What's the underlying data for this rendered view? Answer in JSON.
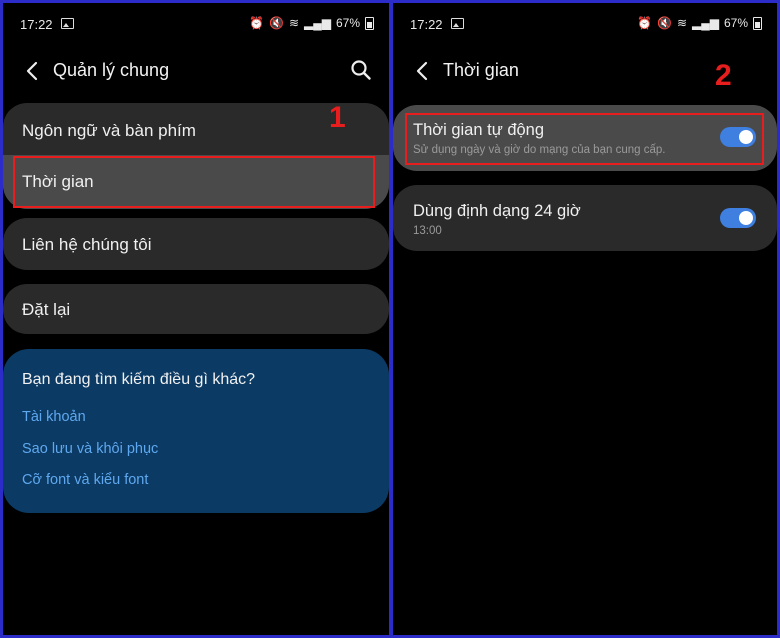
{
  "left": {
    "status": {
      "time": "17:22",
      "battery": "67%"
    },
    "appbar": {
      "title": "Quản lý chung"
    },
    "items": [
      {
        "label": "Ngôn ngữ và bàn phím"
      },
      {
        "label": "Thời gian"
      },
      {
        "label": "Liên hệ chúng tôi"
      },
      {
        "label": "Đặt lại"
      }
    ],
    "step_number": "1",
    "info": {
      "question": "Bạn đang tìm kiếm điều gì khác?",
      "links": [
        "Tài khoản",
        "Sao lưu và khôi phục",
        "Cỡ font và kiểu font"
      ]
    }
  },
  "right": {
    "status": {
      "time": "17:22",
      "battery": "67%"
    },
    "appbar": {
      "title": "Thời gian"
    },
    "step_number": "2",
    "settings": [
      {
        "title": "Thời gian tự động",
        "subtitle": "Sử dụng ngày và giờ do mạng của bạn cung cấp.",
        "on": true
      },
      {
        "title": "Dùng định dạng 24 giờ",
        "subtitle": "13:00",
        "on": true
      }
    ]
  },
  "colors": {
    "frame": "#2c2cc8",
    "card": "#2a2a2a",
    "selected": "#4a4a4a",
    "highlight": "#e81d1d",
    "toggle": "#3e7fe0",
    "link": "#5fa8ef",
    "info_bg": "#0b3a64"
  }
}
